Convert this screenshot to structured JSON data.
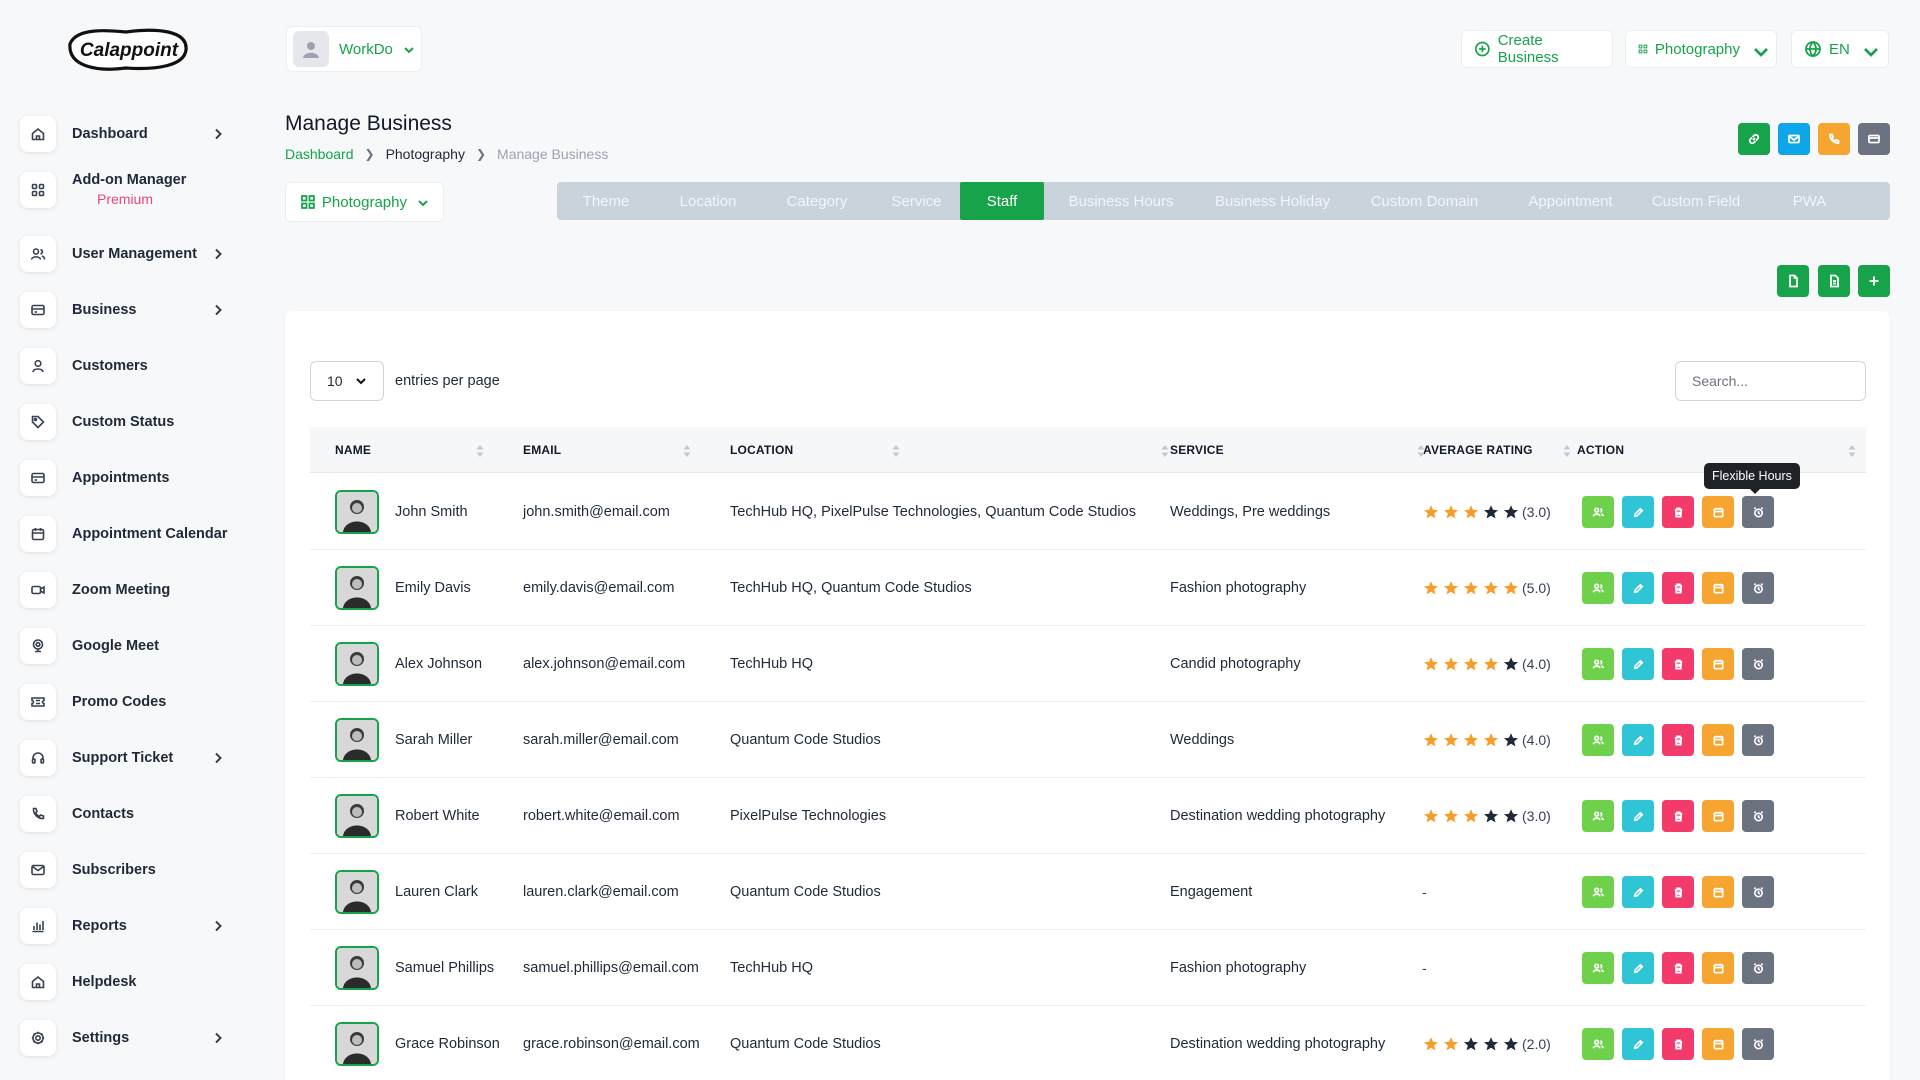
{
  "brand": {
    "logo_text": "Calappoint"
  },
  "sidebar": {
    "items": [
      {
        "label": "Dashboard",
        "icon": "home-icon",
        "chevron": true
      },
      {
        "label": "Add-on Manager",
        "sub": "Premium",
        "icon": "grid-icon",
        "chevron": false
      },
      {
        "label": "User Management",
        "icon": "users-icon",
        "chevron": true
      },
      {
        "label": "Business",
        "icon": "card-icon",
        "chevron": true
      },
      {
        "label": "Customers",
        "icon": "user-icon",
        "chevron": false
      },
      {
        "label": "Custom Status",
        "icon": "tag-icon",
        "chevron": false
      },
      {
        "label": "Appointments",
        "icon": "card-icon",
        "chevron": false
      },
      {
        "label": "Appointment Calendar",
        "icon": "calendar-icon",
        "chevron": false
      },
      {
        "label": "Zoom Meeting",
        "icon": "video-icon",
        "chevron": false
      },
      {
        "label": "Google Meet",
        "icon": "webcam-icon",
        "chevron": false
      },
      {
        "label": "Promo Codes",
        "icon": "ticket-icon",
        "chevron": false
      },
      {
        "label": "Support Ticket",
        "icon": "headset-icon",
        "chevron": true
      },
      {
        "label": "Contacts",
        "icon": "phone-icon",
        "chevron": false
      },
      {
        "label": "Subscribers",
        "icon": "mail-icon",
        "chevron": false
      },
      {
        "label": "Reports",
        "icon": "chart-icon",
        "chevron": true
      },
      {
        "label": "Helpdesk",
        "icon": "home-icon",
        "chevron": false
      },
      {
        "label": "Settings",
        "icon": "gear-icon",
        "chevron": true
      }
    ]
  },
  "topbar": {
    "user_name": "WorkDo",
    "create_business": "Create Business",
    "business_selector": "Photography",
    "language": "EN"
  },
  "page": {
    "title": "Manage Business",
    "breadcrumb": [
      "Dashboard",
      "Photography",
      "Manage Business"
    ],
    "business_select": "Photography"
  },
  "tabs": [
    "Theme",
    "Location",
    "Category",
    "Service",
    "Staff",
    "Business Hours",
    "Business Holiday",
    "Custom Domain",
    "Appointment",
    "Custom Field",
    "PWA"
  ],
  "active_tab": "Staff",
  "table": {
    "entries_value": "10",
    "entries_label": "entries per page",
    "search_placeholder": "Search...",
    "columns": [
      "NAME",
      "EMAIL",
      "LOCATION",
      "SERVICE",
      "AVERAGE RATING",
      "ACTION"
    ],
    "rows": [
      {
        "name": "John Smith",
        "email": "john.smith@email.com",
        "location": "TechHub HQ, PixelPulse Technologies, Quantum Code Studios",
        "service": "Weddings, Pre weddings",
        "rating": 3,
        "rating_text": "(3.0)"
      },
      {
        "name": "Emily Davis",
        "email": "emily.davis@email.com",
        "location": "TechHub HQ, Quantum Code Studios",
        "service": "Fashion photography",
        "rating": 5,
        "rating_text": "(5.0)"
      },
      {
        "name": "Alex Johnson",
        "email": "alex.johnson@email.com",
        "location": "TechHub HQ",
        "service": "Candid photography",
        "rating": 4,
        "rating_text": "(4.0)"
      },
      {
        "name": "Sarah Miller",
        "email": "sarah.miller@email.com",
        "location": "Quantum Code Studios",
        "service": "Weddings",
        "rating": 4,
        "rating_text": "(4.0)"
      },
      {
        "name": "Robert White",
        "email": "robert.white@email.com",
        "location": "PixelPulse Technologies",
        "service": "Destination wedding photography",
        "rating": 3,
        "rating_text": "(3.0)"
      },
      {
        "name": "Lauren Clark",
        "email": "lauren.clark@email.com",
        "location": "Quantum Code Studios",
        "service": "Engagement",
        "rating": null,
        "rating_text": "-"
      },
      {
        "name": "Samuel Phillips",
        "email": "samuel.phillips@email.com",
        "location": "TechHub HQ",
        "service": "Fashion photography",
        "rating": null,
        "rating_text": "-"
      },
      {
        "name": "Grace Robinson",
        "email": "grace.robinson@email.com",
        "location": "Quantum Code Studios",
        "service": "Destination wedding photography",
        "rating": 2,
        "rating_text": "(2.0)"
      }
    ]
  },
  "tooltip": "Flexible Hours",
  "colors": {
    "primary": "#16a34a",
    "tab_bg": "#c9d3dc",
    "action_green": "#6fd14b",
    "action_cyan": "#2fc4d6",
    "action_pink": "#f23a6b",
    "action_orange": "#f7a531",
    "action_gray": "#6b7280",
    "star_on": "#f59e2b",
    "star_off": "#1f2937"
  }
}
